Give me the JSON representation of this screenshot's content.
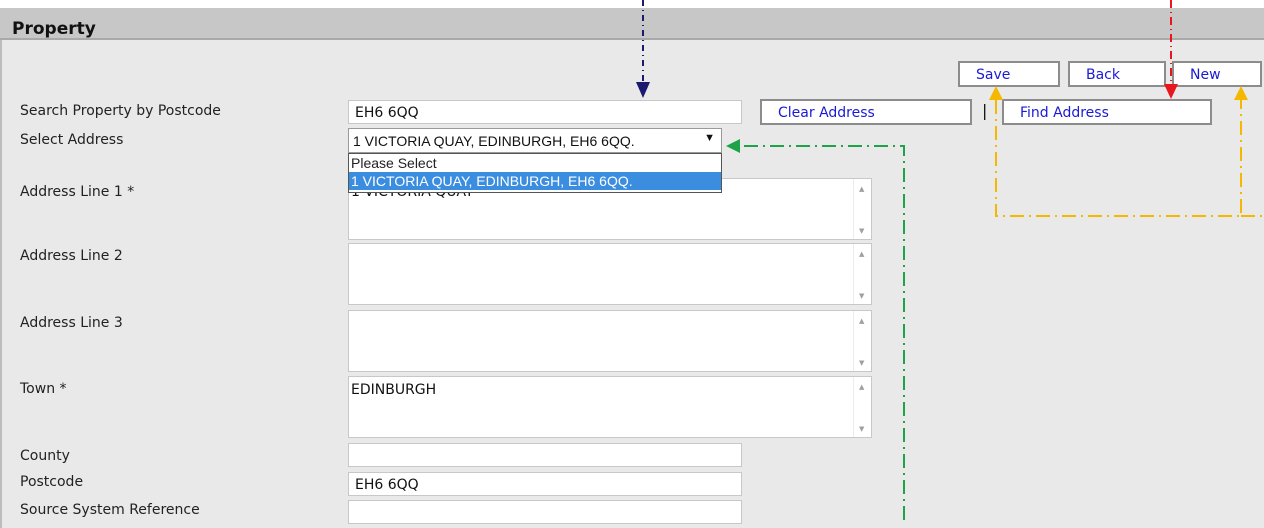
{
  "header": {
    "title": "Property"
  },
  "toolbar": {
    "save": "Save",
    "back": "Back",
    "new": "New"
  },
  "search": {
    "label": "Search Property by Postcode",
    "value": "EH6 6QQ",
    "clear_address": "Clear Address",
    "find_address": "Find Address",
    "separator": "|"
  },
  "select_address": {
    "label": "Select Address",
    "value": "1 VICTORIA QUAY, EDINBURGH, EH6 6QQ.",
    "options": [
      "Please Select",
      "1 VICTORIA QUAY, EDINBURGH, EH6 6QQ."
    ]
  },
  "fields": {
    "address1": {
      "label": "Address Line 1 *",
      "value": "1 VICTORIA QUAY"
    },
    "address2": {
      "label": "Address Line 2",
      "value": ""
    },
    "address3": {
      "label": "Address Line 3",
      "value": ""
    },
    "town": {
      "label": "Town *",
      "value": "EDINBURGH"
    },
    "county": {
      "label": "County",
      "value": ""
    },
    "postcode": {
      "label": "Postcode",
      "value": "EH6 6QQ"
    },
    "source_ref": {
      "label": "Source System Reference",
      "value": ""
    }
  },
  "annotation_colors": {
    "navy": "#1a1a6e",
    "red": "#e8171d",
    "green": "#1fa34a",
    "orange": "#f5b800"
  }
}
